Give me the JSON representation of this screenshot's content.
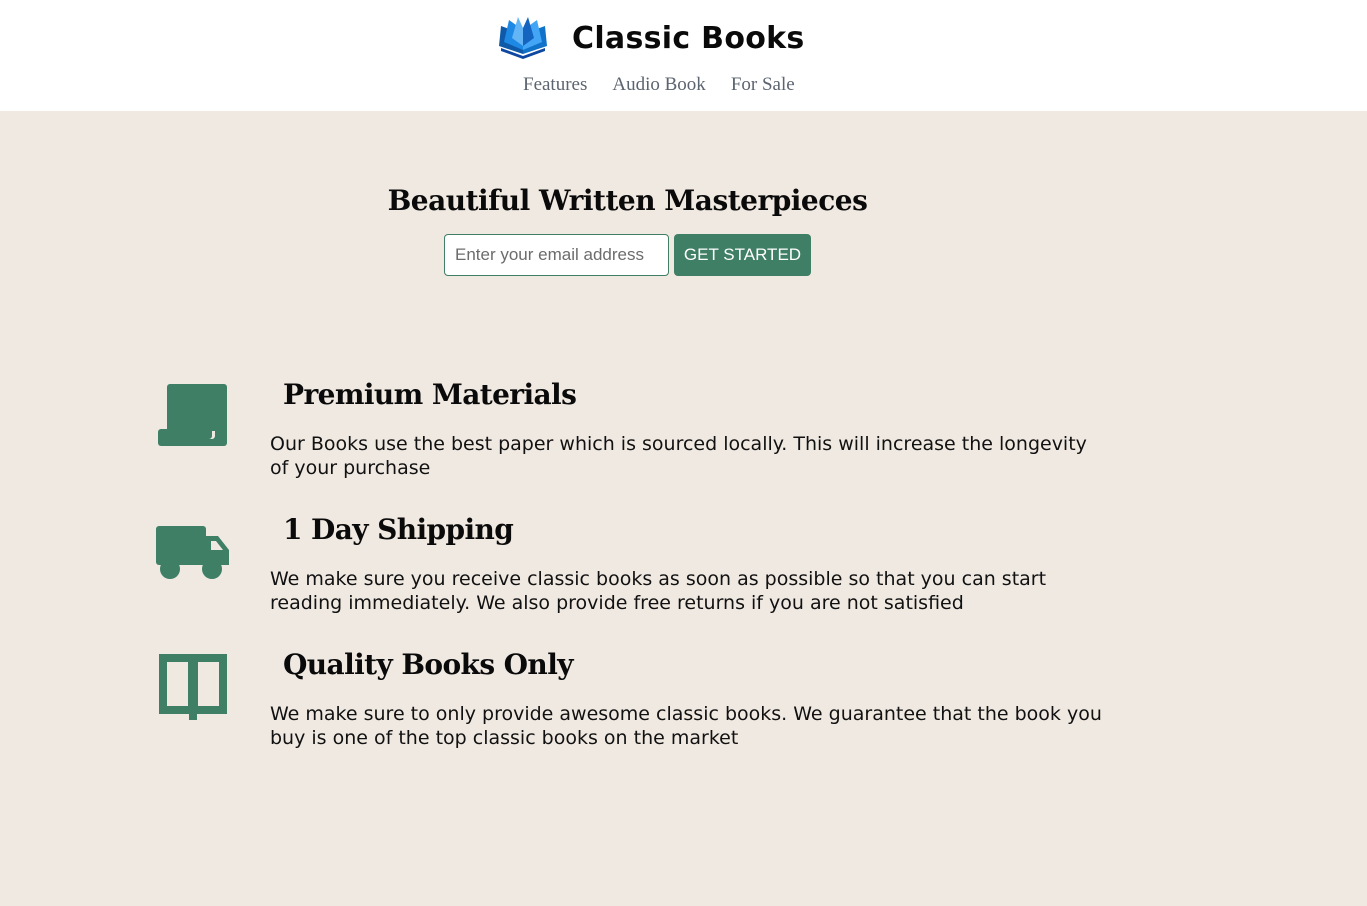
{
  "header": {
    "brand_title": "Classic Books",
    "logo_icon": "open-book-logo-icon",
    "nav": [
      {
        "label": "Features"
      },
      {
        "label": "Audio Book"
      },
      {
        "label": "For Sale"
      }
    ]
  },
  "hero": {
    "title": "Beautiful Written Masterpieces",
    "email_placeholder": "Enter your email address",
    "email_value": "",
    "cta_label": "GET STARTED"
  },
  "features": [
    {
      "icon": "scroll-icon",
      "title": "Premium Materials",
      "text": "Our Books use the best paper which is sourced locally. This will increase the longevity of your purchase"
    },
    {
      "icon": "truck-icon",
      "title": "1 Day Shipping",
      "text": "We make sure you receive classic books as soon as possible so that you can start reading immediately. We also provide free returns if you are not satisfied"
    },
    {
      "icon": "open-book-icon",
      "title": "Quality Books Only",
      "text": "We make sure to only provide awesome classic books. We guarantee that the book you buy is one of the top classic books on the market"
    }
  ],
  "colors": {
    "accent": "#3e7f65",
    "background": "#f0e9e2",
    "header_background": "#ffffff",
    "nav_text": "#5c6470"
  }
}
